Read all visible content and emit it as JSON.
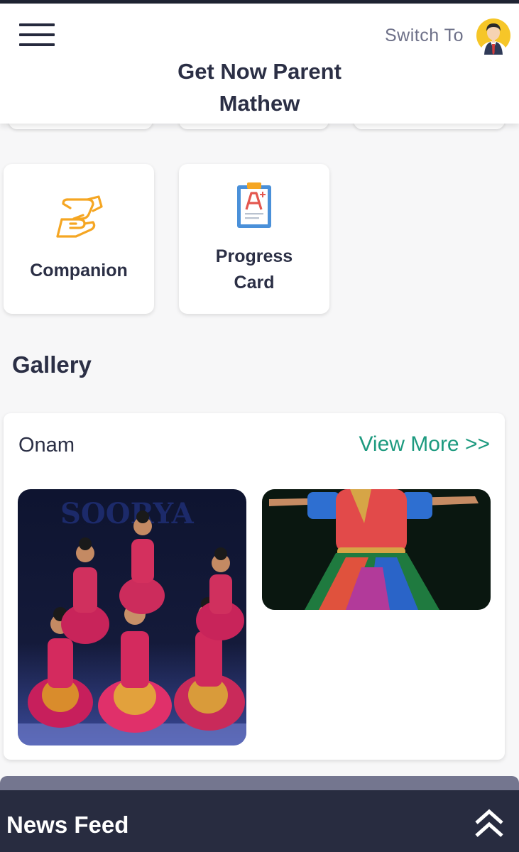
{
  "header": {
    "title_line1": "Get Now Parent",
    "title_line2": "Mathew",
    "switch_label": "Switch To",
    "menu_icon": "hamburger-menu-icon",
    "avatar_icon": "user-avatar-icon"
  },
  "tiles": [
    {
      "label_line1": "Companion",
      "label_line2": "",
      "icon": "handshake-icon",
      "icon_color": "#f5a623"
    },
    {
      "label_line1": "Progress",
      "label_line2": "Card",
      "icon": "report-card-icon",
      "icon_color": "#4a90d9"
    }
  ],
  "gallery": {
    "section_title": "Gallery",
    "album": {
      "name": "Onam",
      "view_more": "View More >>",
      "photos": [
        "dance-group-photo",
        "dancer-solo-photo"
      ],
      "backdrop_text": "SOORYA"
    }
  },
  "news_feed": {
    "label": "News Feed",
    "toggle_icon": "double-chevron-up-icon"
  },
  "colors": {
    "accent": "#1d9a7f",
    "header_text": "#2b2f45",
    "news_bar": "#282c40"
  }
}
